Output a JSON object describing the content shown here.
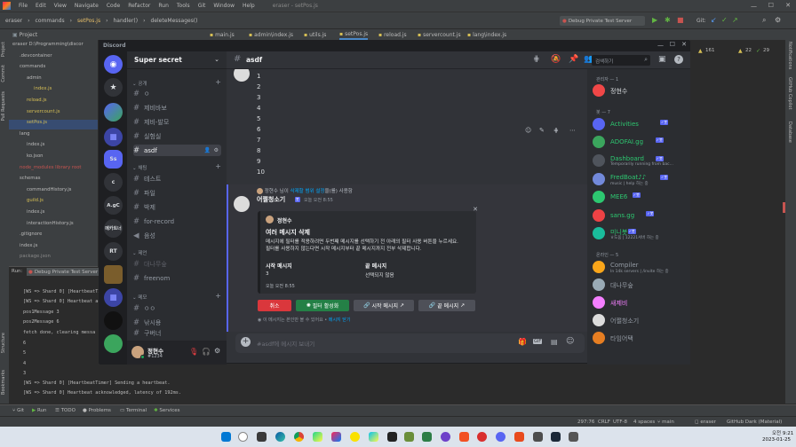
{
  "ide": {
    "menu": [
      "File",
      "Edit",
      "View",
      "Navigate",
      "Code",
      "Refactor",
      "Run",
      "Tools",
      "Git",
      "Window",
      "Help"
    ],
    "window_title": "eraser - setPos.js",
    "breadcrumbs": [
      "eraser",
      "commands",
      "setPos.js",
      "handler()",
      "deleteMessages()"
    ],
    "run_config": "Debug Private Test Server",
    "git_label": "Git:",
    "editor_tabs": [
      "main.js",
      "admin\\index.js",
      "utils.js",
      "setPos.js",
      "reload.js",
      "servercount.js",
      "lang\\index.js"
    ],
    "project_label": "Project",
    "project_tree": [
      {
        "text": "eraser D:\\Programming\\discor",
        "cls": ""
      },
      {
        "text": ".devcontainer",
        "cls": ""
      },
      {
        "text": "commands",
        "cls": ""
      },
      {
        "text": "admin",
        "cls": ""
      },
      {
        "text": "index.js",
        "cls": "y"
      },
      {
        "text": "reload.js",
        "cls": "y"
      },
      {
        "text": "servercount.js",
        "cls": "y"
      },
      {
        "text": "setPos.js",
        "cls": "y"
      },
      {
        "text": "lang",
        "cls": ""
      },
      {
        "text": "index.js",
        "cls": ""
      },
      {
        "text": "ko.json",
        "cls": ""
      },
      {
        "text": "node_modules library root",
        "cls": "r"
      },
      {
        "text": "schemas",
        "cls": ""
      },
      {
        "text": "commandHistory.js",
        "cls": ""
      },
      {
        "text": "guild.js",
        "cls": "y"
      },
      {
        "text": "index.js",
        "cls": ""
      },
      {
        "text": "interactionHistory.js",
        "cls": ""
      },
      {
        "text": ".gitignore",
        "cls": ""
      },
      {
        "text": "index.js",
        "cls": ""
      },
      {
        "text": "package.json",
        "cls": "dim"
      }
    ],
    "run_tab": "Run:",
    "run_config_tab": "Debug Private Test Server",
    "console": [
      "[WS => Shard 0] [HeartbeatTimer] Sending a heartbeat.",
      "[WS => Shard 0] Heartbeat acknowledged, latency of 192ms.",
      "pos1Message 3",
      "pos2Message 6",
      "fetch done, clearing messa",
      "6",
      "5",
      "4",
      "3",
      "[WS => Shard 0] [HeartbeatTimer] Sending a heartbeat.",
      "[WS => Shard 0] Heartbeat acknowledged, latency of 192ms."
    ],
    "bottom_tabs": [
      "Git",
      "Run",
      "TODO",
      "Problems",
      "Terminal",
      "Services"
    ],
    "status": [
      "297:76",
      "CRLF",
      "UTF-8",
      "4 spaces",
      "main",
      "eraser",
      "GitHub Dark (Material)"
    ],
    "left_tools": [
      "Project",
      "Commit",
      "Pull Requests",
      "Structure",
      "Bookmarks"
    ],
    "right_tools": [
      "Notifications",
      "GitHub Copilot",
      "Database"
    ],
    "warnings": {
      "a": "161",
      "b": "22",
      "c": "29"
    }
  },
  "taskbar": {
    "time": "오전 9:21",
    "date": "2023-01-25"
  },
  "discord": {
    "app_name": "Discord",
    "server_name": "Super secret",
    "guild_labels": [
      "Ss",
      "c",
      "A.gC",
      "메카트너",
      "RT"
    ],
    "categories": {
      "public": "공개",
      "share": "채팅",
      "related": "제언",
      "other": "메모"
    },
    "channels": [
      "ㅇ",
      "제비바보",
      "제비-발모",
      "실험실",
      "asdf",
      "테스트",
      "파일",
      "박제",
      "for-record",
      "음성",
      "대나무숲",
      "freenom",
      "ㅇㅇ",
      "낚시용",
      "구버너"
    ],
    "current_channel": "asdf",
    "search_placeholder": "검색하기",
    "user": {
      "name": "정현수",
      "tag": "#1234"
    },
    "numbers": [
      "1",
      "2",
      "3",
      "4",
      "5",
      "6",
      "7",
      "8",
      "9",
      "10"
    ],
    "system_line": {
      "user": "정현수",
      "text1": " 님이 ",
      "command": "삭제할 범위 설정",
      "text2": "을(를) 사용함"
    },
    "bot_message": {
      "author": "어쩔청소기",
      "bot_tag": "봇",
      "time": "오늘 오전 8:55"
    },
    "embed": {
      "author": "정현수",
      "title": "여러 메시지 삭제",
      "desc": "메시지에 필터를 적용하려면 두번째 메시지를 선택하기 전 아래의 필터 사용 버튼을 누르세요.\n필터를 사용하지 않는다면 시작 메시지부터 끝 메시지까지 전부 삭제합니다.",
      "field1_name": "시작 메시지",
      "field1_value": "3",
      "field2_name": "끝 메시지",
      "field2_value": "선택되지 않음",
      "footer": "오늘 오전 8:55"
    },
    "buttons": {
      "cancel": "취소",
      "filter": "필터 활성화",
      "start": "시작 메시지",
      "end": "끝 메시지"
    },
    "ephemeral": {
      "text": "이 메시지는 본인만 볼 수 있어요 • ",
      "link": "메시지 닫기"
    },
    "input_placeholder": "#asdf에 메시지 보내기",
    "members": {
      "admin_header": "관리자 — 1",
      "bot_header": "봇 — 7",
      "online_header": "온라인 — 5",
      "admins": [
        {
          "name": "정현수",
          "color": "#dbdee1"
        }
      ],
      "bots": [
        {
          "name": "Activities",
          "sub": "",
          "color": "#2dc770"
        },
        {
          "name": "ADOFAI.gg",
          "sub": "",
          "color": "#2dc770"
        },
        {
          "name": "Dashboard",
          "sub": "Temporarily running from bac...",
          "color": "#2dc770"
        },
        {
          "name": "FredBoat♪♪",
          "sub": "music | help 하는 중",
          "color": "#2dc770"
        },
        {
          "name": "MEE6",
          "sub": "",
          "color": "#2dc770"
        },
        {
          "name": "sans.gg",
          "sub": "",
          "color": "#2dc770"
        },
        {
          "name": "미니봇",
          "sub": "ㅎ도움 | 12221서버 하는 중",
          "color": "#2dc770"
        }
      ],
      "online": [
        {
          "name": "Compiler",
          "sub": "In 14k servers | /invite 하는 중",
          "color": "#949ba4"
        },
        {
          "name": "대나무숲",
          "sub": "",
          "color": "#949ba4"
        },
        {
          "name": "새제비",
          "sub": "",
          "color": "#f47fff"
        },
        {
          "name": "어쩔청소기",
          "sub": "",
          "color": "#949ba4"
        },
        {
          "name": "타임어택",
          "sub": "",
          "color": "#949ba4"
        }
      ]
    }
  }
}
